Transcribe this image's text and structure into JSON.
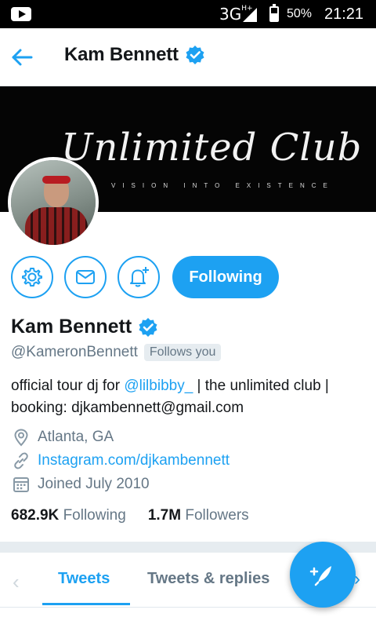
{
  "status_bar": {
    "network": "3G",
    "network_sup": "H+",
    "battery": "50%",
    "time": "21:21"
  },
  "header": {
    "title": "Kam Bennett"
  },
  "banner": {
    "brand": "Unlimited Club",
    "tagline": "VISION INTO EXISTENCE"
  },
  "actions": {
    "following_label": "Following"
  },
  "profile": {
    "name": "Kam Bennett",
    "handle": "@KameronBennett",
    "follows_you": "Follows you",
    "bio_prefix": "official tour dj for ",
    "bio_mention": "@lilbibby_",
    "bio_suffix": " | the unlimited club | booking: djkambennett@gmail.com",
    "location": "Atlanta, GA",
    "website": "Instagram.com/djkambennett",
    "joined": "Joined July 2010",
    "following_count": "682.9K",
    "following_label": "Following",
    "followers_count": "1.7M",
    "followers_label": "Followers"
  },
  "tabs": [
    {
      "label": "Tweets"
    },
    {
      "label": "Tweets & replies"
    }
  ],
  "colors": {
    "accent": "#1da1f2",
    "muted": "#657786"
  }
}
